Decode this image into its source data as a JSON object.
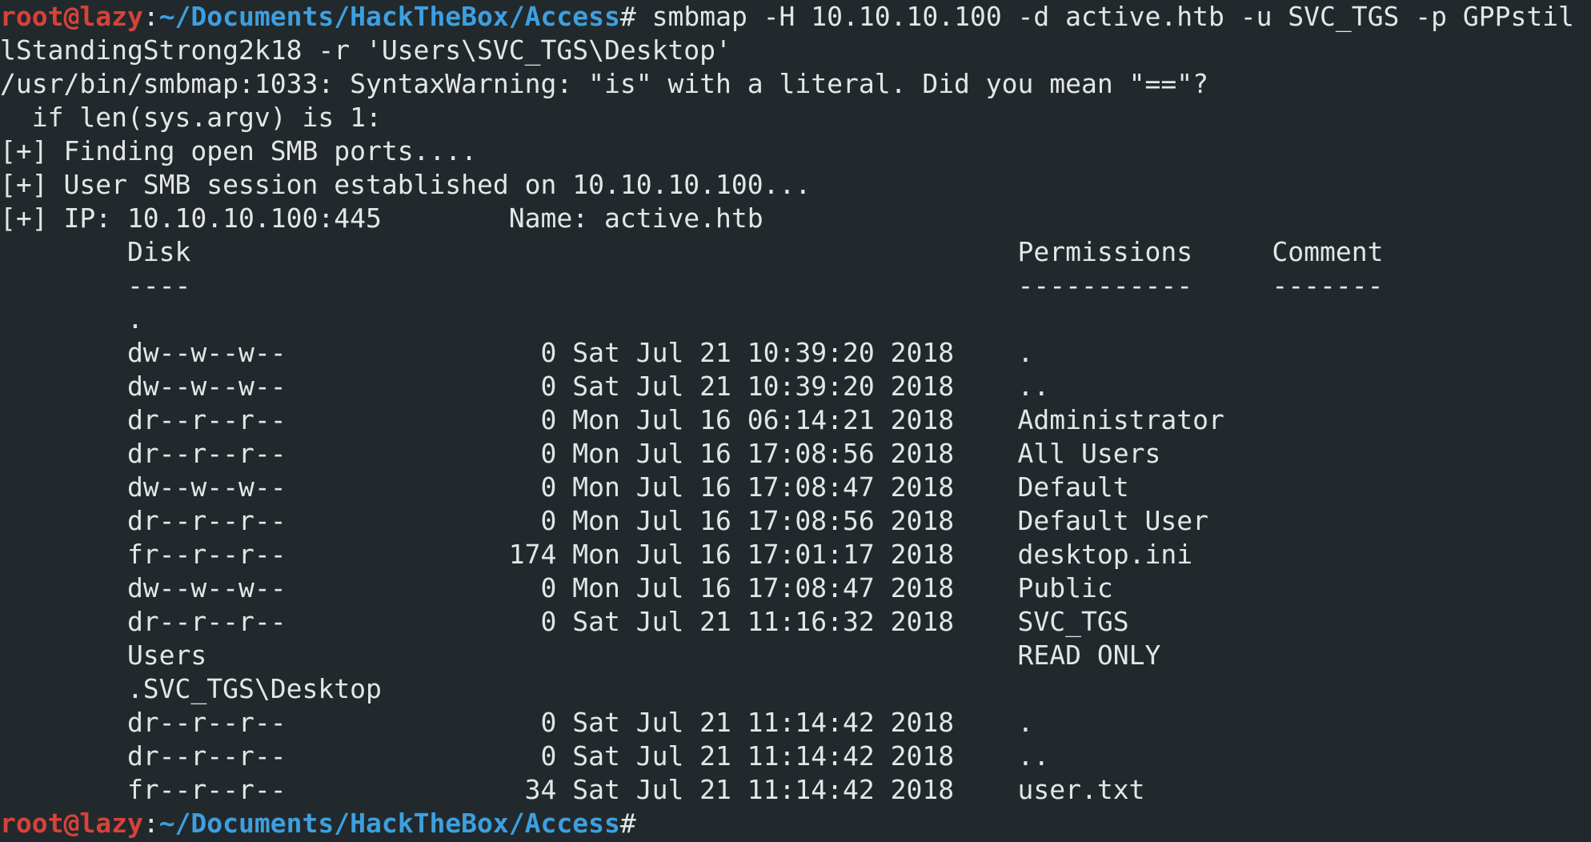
{
  "prompt": {
    "user_host": "root@lazy",
    "separator": ":",
    "path": "~/Documents/HackTheBox/Access",
    "symbol": "#"
  },
  "command": {
    "text": " smbmap -H 10.10.10.100 -d active.htb -u SVC_TGS -p GPPstil",
    "wrap": "lStandingStrong2k18 -r 'Users\\SVC_TGS\\Desktop'"
  },
  "output": [
    "/usr/bin/smbmap:1033: SyntaxWarning: \"is\" with a literal. Did you mean \"==\"?",
    "  if len(sys.argv) is 1:",
    "[+] Finding open SMB ports....",
    "[+] User SMB session established on 10.10.10.100...",
    "[+] IP: 10.10.10.100:445        Name: active.htb",
    "        Disk                                                    Permissions     Comment",
    "        ----                                                    -----------     -------",
    "        .",
    "        dw--w--w--                0 Sat Jul 21 10:39:20 2018    .",
    "        dw--w--w--                0 Sat Jul 21 10:39:20 2018    ..",
    "        dr--r--r--                0 Mon Jul 16 06:14:21 2018    Administrator",
    "        dr--r--r--                0 Mon Jul 16 17:08:56 2018    All Users",
    "        dw--w--w--                0 Mon Jul 16 17:08:47 2018    Default",
    "        dr--r--r--                0 Mon Jul 16 17:08:56 2018    Default User",
    "        fr--r--r--              174 Mon Jul 16 17:01:17 2018    desktop.ini",
    "        dw--w--w--                0 Mon Jul 16 17:08:47 2018    Public",
    "        dr--r--r--                0 Sat Jul 21 11:16:32 2018    SVC_TGS",
    "        Users                                                   READ ONLY",
    "        .SVC_TGS\\Desktop",
    "        dr--r--r--                0 Sat Jul 21 11:14:42 2018    .",
    "        dr--r--r--                0 Sat Jul 21 11:14:42 2018    ..",
    "        fr--r--r--               34 Sat Jul 21 11:14:42 2018    user.txt"
  ],
  "colors": {
    "background": "#22292c",
    "foreground": "#e4e6e6",
    "prompt_user": "#d7423a",
    "prompt_path": "#3d9fe0"
  }
}
